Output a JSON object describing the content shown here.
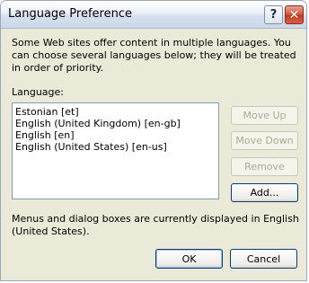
{
  "window": {
    "title": "Language Preference",
    "help_label": "?",
    "close_label": "✕"
  },
  "intro_text": "Some Web sites offer content in multiple languages. You can choose several languages below; they will be treated in order of priority.",
  "language_label": "Language:",
  "languages": [
    "Estonian [et]",
    "English (United Kingdom) [en-gb]",
    "English [en]",
    "English (United States) [en-us]"
  ],
  "buttons": {
    "move_up": "Move Up",
    "move_down": "Move Down",
    "remove": "Remove",
    "add": "Add..."
  },
  "footer_text": "Menus and dialog boxes are currently displayed in English (United States).",
  "ok_label": "OK",
  "cancel_label": "Cancel"
}
